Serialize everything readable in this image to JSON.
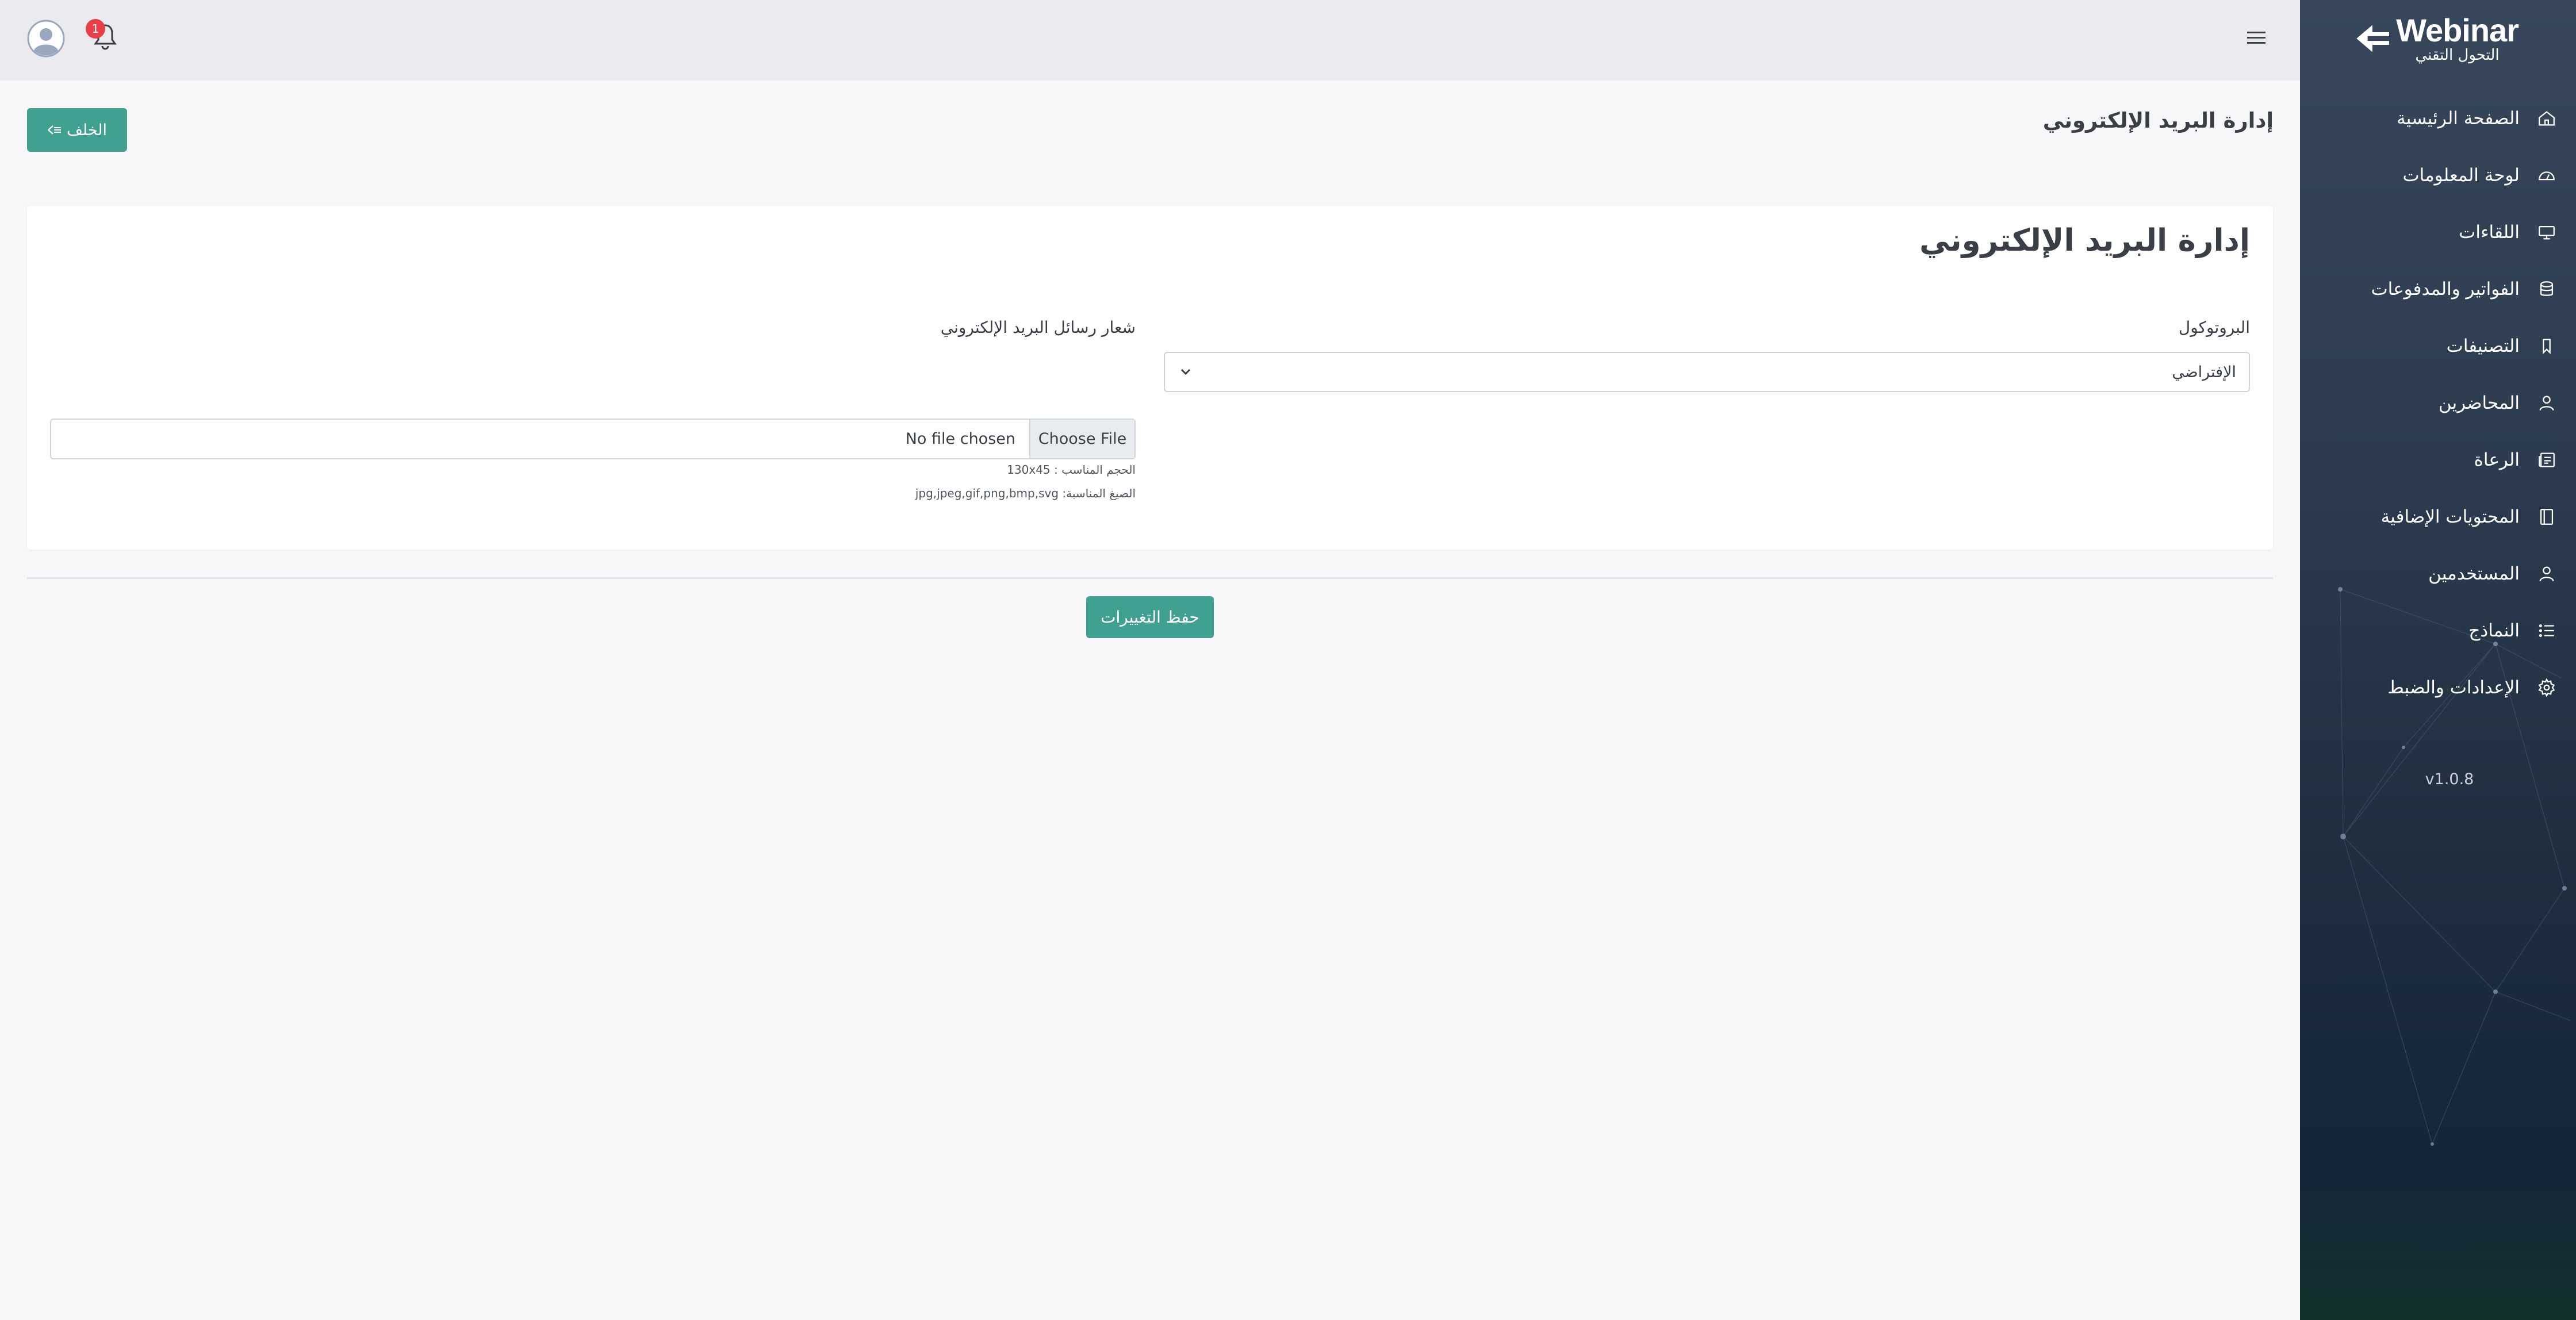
{
  "logo": {
    "title": "Webinar",
    "subtitle": "التحول التقني"
  },
  "sidebar": {
    "items": [
      {
        "label": "الصفحة الرئيسية",
        "icon": "home-icon"
      },
      {
        "label": "لوحة المعلومات",
        "icon": "dashboard-gauge-icon"
      },
      {
        "label": "اللقاءات",
        "icon": "monitor-icon"
      },
      {
        "label": "الفواتير والمدفوعات",
        "icon": "database-icon"
      },
      {
        "label": "التصنيفات",
        "icon": "bookmark-icon"
      },
      {
        "label": "المحاضرين",
        "icon": "user-icon"
      },
      {
        "label": "الرعاة",
        "icon": "newspaper-icon"
      },
      {
        "label": "المحتويات الإضافية",
        "icon": "book-icon"
      },
      {
        "label": "المستخدمين",
        "icon": "user-icon"
      },
      {
        "label": "النماذج",
        "icon": "list-icon"
      },
      {
        "label": "الإعدادات والضبط",
        "icon": "gear-icon"
      }
    ],
    "version": "v1.0.8"
  },
  "topbar": {
    "notification_count": "1"
  },
  "page": {
    "title": "إدارة البريد الإلكتروني",
    "back_label": "الخلف"
  },
  "card": {
    "title": "إدارة البريد الإلكتروني",
    "protocol_label": "البروتوكول",
    "protocol_value": "الإفتراضي",
    "logo_label": "شعار رسائل البريد الإلكتروني",
    "file_button": "Choose File",
    "file_status": "No file chosen",
    "size_hint": "الحجم المناسب : 130x45",
    "formats_hint": "الصيغ المناسبة: jpg,jpeg,gif,png,bmp,svg"
  },
  "save_label": "حفظ التغييرات",
  "colors": {
    "accent": "#40a191",
    "badge": "#e83e45",
    "sidebar": "#2c3b4f"
  }
}
